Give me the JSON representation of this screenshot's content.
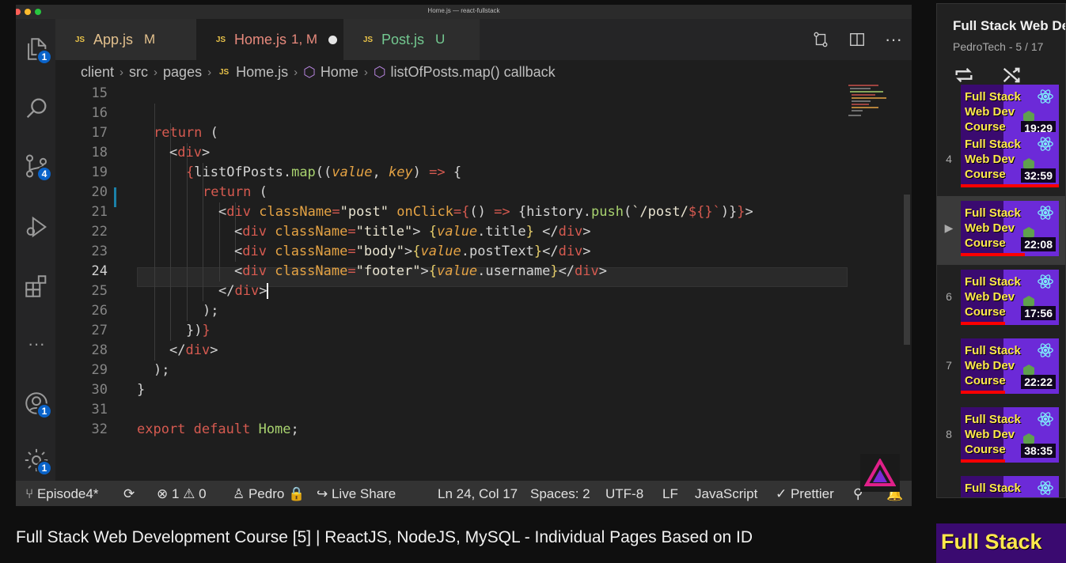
{
  "window": {
    "title": "Home.js — react-fullstack"
  },
  "activity_bar": {
    "explorer_badge": "1",
    "source_control_badge": "4",
    "accounts_badge": "1",
    "settings_badge": "1"
  },
  "tabs": [
    {
      "label": "App.js",
      "status": "M"
    },
    {
      "label": "Home.js",
      "status": "1, M"
    },
    {
      "label": "Post.js",
      "status": "U"
    }
  ],
  "breadcrumb": {
    "items": [
      "client",
      "src",
      "pages",
      "Home.js",
      "Home",
      "listOfPosts.map() callback"
    ]
  },
  "editor": {
    "line_numbers": [
      "15",
      "16",
      "17",
      "18",
      "19",
      "20",
      "21",
      "22",
      "23",
      "24",
      "25",
      "26",
      "27",
      "28",
      "29",
      "30",
      "31",
      "32"
    ],
    "current_line": "24",
    "code": {
      "l16_return": "return",
      "l16_paren": " (",
      "l17_div": "div",
      "l18_list": "listOfPosts.",
      "l18_map": "map",
      "l18_value": "value",
      "l18_key": "key",
      "l18_arrow": "=>",
      "l19_return": "return",
      "l20_attr": "className",
      "l20_str": "\"post\"",
      "l20_onclick": "onClick",
      "l20_history": "history.",
      "l20_push": "push",
      "l20_tpl": "`/post/",
      "l20_dollar": "${",
      "l20_close": "}`",
      "l21_str": "\"title\"",
      "l21_expr": "title",
      "l22_str": "\"body\"",
      "l22_expr": "postText",
      "l23_str": "\"footer\"",
      "l23_expr": "username",
      "l31_export": "export",
      "l31_default": "default",
      "l31_home": "Home"
    }
  },
  "status_bar": {
    "branch": "Episode4*",
    "errors": "1",
    "warnings": "0",
    "user": "Pedro",
    "live_share": "Live Share",
    "cursor": "Ln 24, Col 17",
    "spaces": "Spaces: 2",
    "encoding": "UTF-8",
    "eol": "LF",
    "language": "JavaScript",
    "formatter": "Prettier"
  },
  "video": {
    "title": "Full Stack Web Development Course [5] | ReactJS, NodeJS, MySQL - Individual Pages Based on ID"
  },
  "playlist": {
    "title": "Full Stack Web De",
    "subtitle": "PedroTech - 5 / 17",
    "thumb_text": [
      "Full Stack",
      "Web Dev",
      "Course"
    ],
    "items": [
      {
        "index": "",
        "duration": "19:29",
        "progress": 1.0
      },
      {
        "index": "4",
        "duration": "32:59",
        "progress": 1.0
      },
      {
        "index": "▶",
        "duration": "22:08",
        "progress": 0.65
      },
      {
        "index": "6",
        "duration": "17:56",
        "progress": 0.45
      },
      {
        "index": "7",
        "duration": "22:22",
        "progress": 0.45
      },
      {
        "index": "8",
        "duration": "38:35",
        "progress": 0.45
      },
      {
        "index": "",
        "duration": "",
        "progress": 0
      }
    ],
    "next_thumb_text": "Full Stack",
    "colors": {
      "thumb_text": "#ffe84d",
      "progress": "#ff0000"
    }
  }
}
